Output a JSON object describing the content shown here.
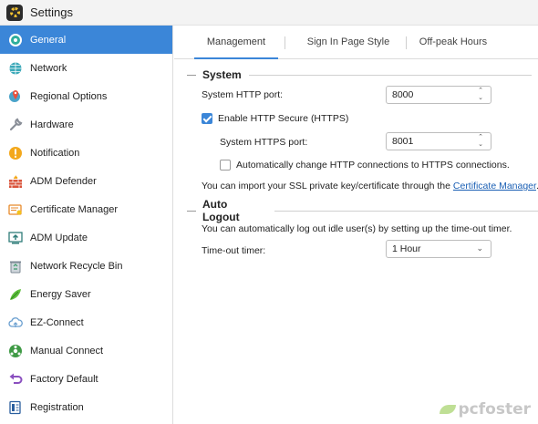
{
  "window": {
    "title": "Settings",
    "icon": "gear-app-icon"
  },
  "sidebar": {
    "items": [
      {
        "label": "General",
        "icon": "general-icon",
        "active": true
      },
      {
        "label": "Network",
        "icon": "globe-icon"
      },
      {
        "label": "Regional Options",
        "icon": "regional-icon"
      },
      {
        "label": "Hardware",
        "icon": "wrench-icon"
      },
      {
        "label": "Notification",
        "icon": "notification-icon"
      },
      {
        "label": "ADM Defender",
        "icon": "firewall-icon"
      },
      {
        "label": "Certificate Manager",
        "icon": "certificate-icon"
      },
      {
        "label": "ADM Update",
        "icon": "update-icon"
      },
      {
        "label": "Network Recycle Bin",
        "icon": "recycle-bin-icon"
      },
      {
        "label": "Energy Saver",
        "icon": "energy-icon"
      },
      {
        "label": "EZ-Connect",
        "icon": "cloud-icon"
      },
      {
        "label": "Manual Connect",
        "icon": "manual-connect-icon"
      },
      {
        "label": "Factory Default",
        "icon": "undo-icon"
      },
      {
        "label": "Registration",
        "icon": "registration-icon"
      }
    ]
  },
  "tabs": [
    {
      "label": "Management",
      "active": true
    },
    {
      "label": "Sign In Page Style"
    },
    {
      "label": "Off-peak Hours"
    }
  ],
  "system": {
    "heading": "System",
    "http_port_label": "System HTTP port:",
    "http_port_value": "8000",
    "https_checkbox_label": "Enable HTTP Secure (HTTPS)",
    "https_checked": true,
    "https_port_label": "System HTTPS port:",
    "https_port_value": "8001",
    "auto_redirect_label": "Automatically change HTTP connections to HTTPS connections.",
    "auto_redirect_checked": false,
    "import_text": "You can import your SSL private key/certificate through the",
    "import_link": "Certificate Manager",
    "import_suffix": "."
  },
  "auto_logout": {
    "heading": "Auto Logout",
    "description": "You can automatically log out idle user(s) by setting up the time-out timer.",
    "timer_label": "Time-out timer:",
    "timer_value": "1 Hour"
  },
  "watermark": {
    "text": "pcfoster"
  },
  "colors": {
    "accent": "#3b86d8",
    "link": "#1a5fb4"
  }
}
